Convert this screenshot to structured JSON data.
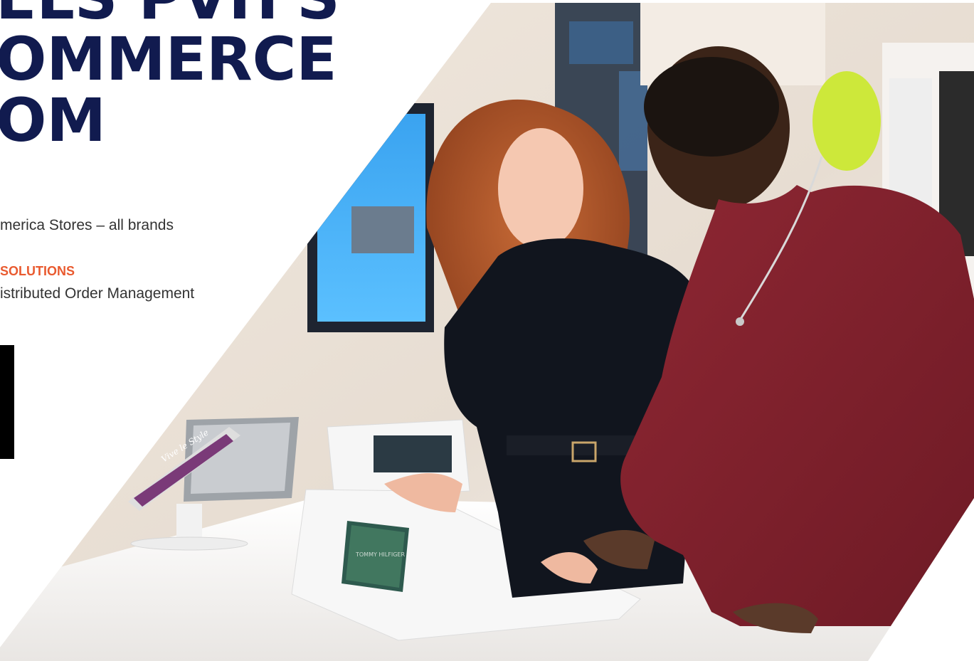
{
  "headline": {
    "line1": "ELS PVH'S",
    "line2": "OMMERCE",
    "line3": "OM"
  },
  "details": {
    "stores": "merica Stores – all brands",
    "solutions_label": "SOLUTIONS",
    "solution_value": "istributed Order Management"
  },
  "photo": {
    "store_brand_text": "TOMMY HILFIGER",
    "tablet_screen_text": "Vive le Style"
  },
  "colors": {
    "headline": "#111b4f",
    "accent": "#e95a2f",
    "body_text": "#333333"
  }
}
